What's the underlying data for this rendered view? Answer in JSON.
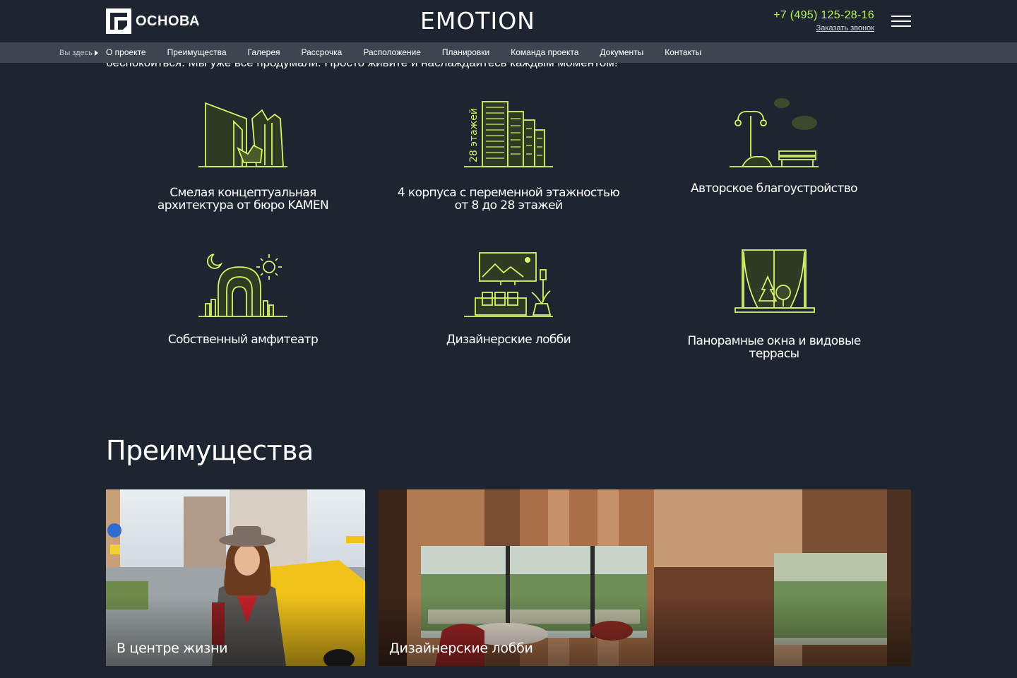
{
  "header": {
    "logo_text": "ОСНОВА",
    "brand": "EMOTION",
    "phone": "+7 (495) 125-28-16",
    "callback": "Заказать звонок",
    "accent_color": "#b8f26a"
  },
  "subnav": {
    "here": "Вы здесь",
    "links": [
      "О проекте",
      "Преимущества",
      "Галерея",
      "Рассрочка",
      "Расположение",
      "Планировки",
      "Команда проекта",
      "Документы",
      "Контакты"
    ]
  },
  "intro_cut": "беспокоиться. Мы уже все продумали. Просто живите и наслаждайтесь каждым моментом!",
  "features": [
    {
      "icon": "architecture-icon",
      "line1": "Смелая концептуальная",
      "line2": "архитектура от бюро KAMEN"
    },
    {
      "icon": "towers-icon",
      "line1": "4 корпуса с переменной этажностью",
      "line2": "от 8 до 28 этажей",
      "icon_label": "28 этажей"
    },
    {
      "icon": "landscape-icon",
      "line1": "Авторское благоустройство",
      "line2": ""
    },
    {
      "icon": "amphitheater-icon",
      "line1": "Собственный амфитеатр",
      "line2": ""
    },
    {
      "icon": "lobby-icon",
      "line1": "Дизайнерские лобби",
      "line2": ""
    },
    {
      "icon": "window-icon",
      "line1": "Панорамные окна и видовые террасы",
      "line2": ""
    }
  ],
  "advantages": {
    "title": "Преимущества",
    "cards": [
      {
        "label": "В центре жизни"
      },
      {
        "label": "Дизайнерские лобби"
      }
    ]
  }
}
